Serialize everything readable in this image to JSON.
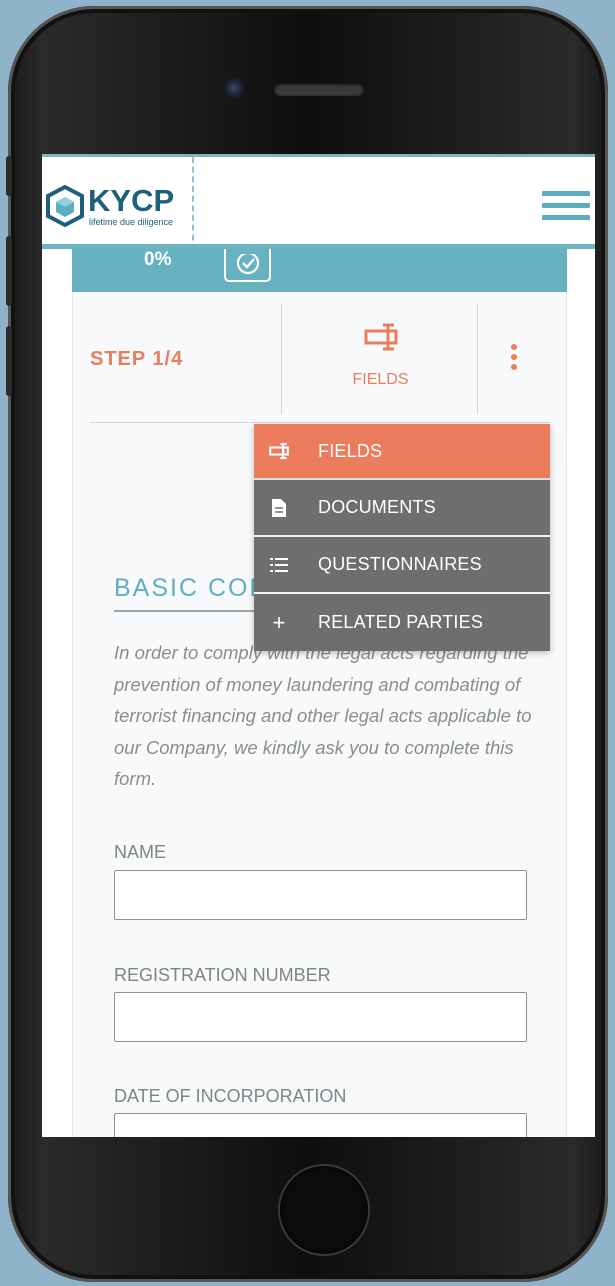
{
  "brand": {
    "name": "KYCP",
    "tagline": "lifetime due diligence"
  },
  "progress": {
    "percent_label": "0%",
    "value": 0
  },
  "wizard": {
    "step_label": "STEP 1/4",
    "active_tab_label": "FIELDS"
  },
  "menu": {
    "items": [
      {
        "label": "FIELDS",
        "icon": "fields-icon",
        "active": true
      },
      {
        "label": "DOCUMENTS",
        "icon": "document-icon",
        "active": false
      },
      {
        "label": "QUESTIONNAIRES",
        "icon": "list-icon",
        "active": false
      },
      {
        "label": "RELATED PARTIES",
        "icon": "plus-icon",
        "active": false
      }
    ]
  },
  "form": {
    "section_title": "BASIC COR",
    "intro": "In order to comply with the legal acts regarding the prevention of money laundering and combating of terrorist financing and other legal acts applicable to our Company, we kindly ask you to complete this form.",
    "fields": [
      {
        "label": "NAME",
        "value": ""
      },
      {
        "label": "REGISTRATION NUMBER",
        "value": ""
      },
      {
        "label": "DATE OF INCORPORATION",
        "value": ""
      }
    ]
  },
  "colors": {
    "accent_orange": "#e87e5d",
    "accent_teal": "#66b2c1",
    "brand_navy": "#1e5f7b",
    "menu_gray": "#706e6d"
  }
}
